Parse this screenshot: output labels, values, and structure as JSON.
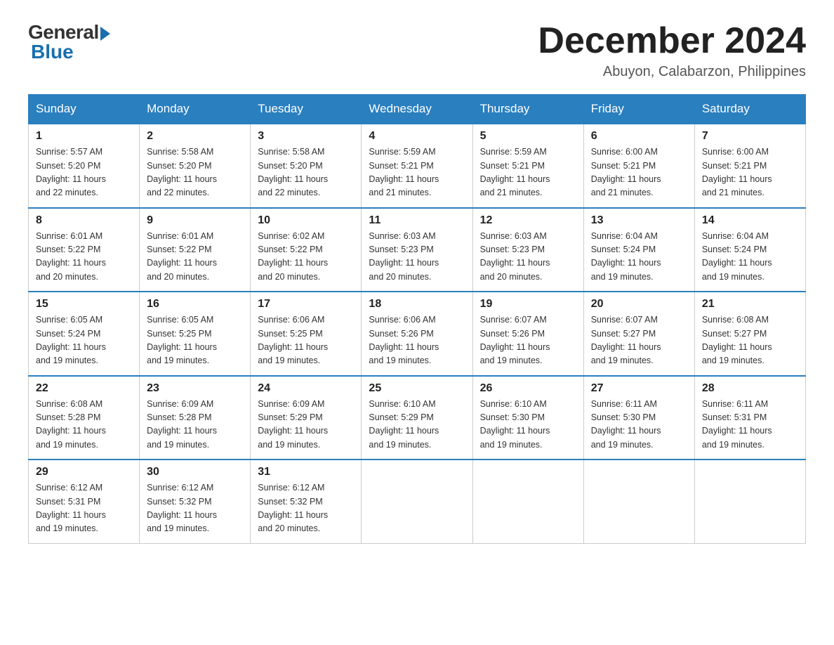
{
  "logo": {
    "general": "General",
    "blue": "Blue"
  },
  "title": "December 2024",
  "location": "Abuyon, Calabarzon, Philippines",
  "headers": [
    "Sunday",
    "Monday",
    "Tuesday",
    "Wednesday",
    "Thursday",
    "Friday",
    "Saturday"
  ],
  "weeks": [
    [
      {
        "day": "1",
        "info": "Sunrise: 5:57 AM\nSunset: 5:20 PM\nDaylight: 11 hours\nand 22 minutes."
      },
      {
        "day": "2",
        "info": "Sunrise: 5:58 AM\nSunset: 5:20 PM\nDaylight: 11 hours\nand 22 minutes."
      },
      {
        "day": "3",
        "info": "Sunrise: 5:58 AM\nSunset: 5:20 PM\nDaylight: 11 hours\nand 22 minutes."
      },
      {
        "day": "4",
        "info": "Sunrise: 5:59 AM\nSunset: 5:21 PM\nDaylight: 11 hours\nand 21 minutes."
      },
      {
        "day": "5",
        "info": "Sunrise: 5:59 AM\nSunset: 5:21 PM\nDaylight: 11 hours\nand 21 minutes."
      },
      {
        "day": "6",
        "info": "Sunrise: 6:00 AM\nSunset: 5:21 PM\nDaylight: 11 hours\nand 21 minutes."
      },
      {
        "day": "7",
        "info": "Sunrise: 6:00 AM\nSunset: 5:21 PM\nDaylight: 11 hours\nand 21 minutes."
      }
    ],
    [
      {
        "day": "8",
        "info": "Sunrise: 6:01 AM\nSunset: 5:22 PM\nDaylight: 11 hours\nand 20 minutes."
      },
      {
        "day": "9",
        "info": "Sunrise: 6:01 AM\nSunset: 5:22 PM\nDaylight: 11 hours\nand 20 minutes."
      },
      {
        "day": "10",
        "info": "Sunrise: 6:02 AM\nSunset: 5:22 PM\nDaylight: 11 hours\nand 20 minutes."
      },
      {
        "day": "11",
        "info": "Sunrise: 6:03 AM\nSunset: 5:23 PM\nDaylight: 11 hours\nand 20 minutes."
      },
      {
        "day": "12",
        "info": "Sunrise: 6:03 AM\nSunset: 5:23 PM\nDaylight: 11 hours\nand 20 minutes."
      },
      {
        "day": "13",
        "info": "Sunrise: 6:04 AM\nSunset: 5:24 PM\nDaylight: 11 hours\nand 19 minutes."
      },
      {
        "day": "14",
        "info": "Sunrise: 6:04 AM\nSunset: 5:24 PM\nDaylight: 11 hours\nand 19 minutes."
      }
    ],
    [
      {
        "day": "15",
        "info": "Sunrise: 6:05 AM\nSunset: 5:24 PM\nDaylight: 11 hours\nand 19 minutes."
      },
      {
        "day": "16",
        "info": "Sunrise: 6:05 AM\nSunset: 5:25 PM\nDaylight: 11 hours\nand 19 minutes."
      },
      {
        "day": "17",
        "info": "Sunrise: 6:06 AM\nSunset: 5:25 PM\nDaylight: 11 hours\nand 19 minutes."
      },
      {
        "day": "18",
        "info": "Sunrise: 6:06 AM\nSunset: 5:26 PM\nDaylight: 11 hours\nand 19 minutes."
      },
      {
        "day": "19",
        "info": "Sunrise: 6:07 AM\nSunset: 5:26 PM\nDaylight: 11 hours\nand 19 minutes."
      },
      {
        "day": "20",
        "info": "Sunrise: 6:07 AM\nSunset: 5:27 PM\nDaylight: 11 hours\nand 19 minutes."
      },
      {
        "day": "21",
        "info": "Sunrise: 6:08 AM\nSunset: 5:27 PM\nDaylight: 11 hours\nand 19 minutes."
      }
    ],
    [
      {
        "day": "22",
        "info": "Sunrise: 6:08 AM\nSunset: 5:28 PM\nDaylight: 11 hours\nand 19 minutes."
      },
      {
        "day": "23",
        "info": "Sunrise: 6:09 AM\nSunset: 5:28 PM\nDaylight: 11 hours\nand 19 minutes."
      },
      {
        "day": "24",
        "info": "Sunrise: 6:09 AM\nSunset: 5:29 PM\nDaylight: 11 hours\nand 19 minutes."
      },
      {
        "day": "25",
        "info": "Sunrise: 6:10 AM\nSunset: 5:29 PM\nDaylight: 11 hours\nand 19 minutes."
      },
      {
        "day": "26",
        "info": "Sunrise: 6:10 AM\nSunset: 5:30 PM\nDaylight: 11 hours\nand 19 minutes."
      },
      {
        "day": "27",
        "info": "Sunrise: 6:11 AM\nSunset: 5:30 PM\nDaylight: 11 hours\nand 19 minutes."
      },
      {
        "day": "28",
        "info": "Sunrise: 6:11 AM\nSunset: 5:31 PM\nDaylight: 11 hours\nand 19 minutes."
      }
    ],
    [
      {
        "day": "29",
        "info": "Sunrise: 6:12 AM\nSunset: 5:31 PM\nDaylight: 11 hours\nand 19 minutes."
      },
      {
        "day": "30",
        "info": "Sunrise: 6:12 AM\nSunset: 5:32 PM\nDaylight: 11 hours\nand 19 minutes."
      },
      {
        "day": "31",
        "info": "Sunrise: 6:12 AM\nSunset: 5:32 PM\nDaylight: 11 hours\nand 20 minutes."
      },
      {
        "day": "",
        "info": ""
      },
      {
        "day": "",
        "info": ""
      },
      {
        "day": "",
        "info": ""
      },
      {
        "day": "",
        "info": ""
      }
    ]
  ]
}
